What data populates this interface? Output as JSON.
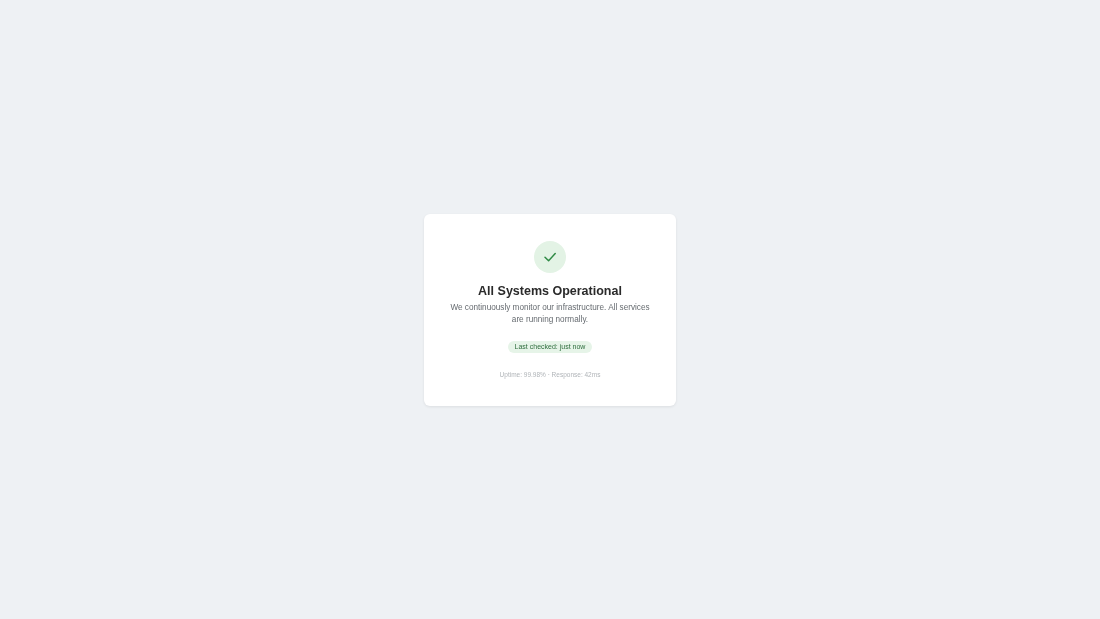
{
  "status_card": {
    "title": "All Systems Operational",
    "description": "We continuously monitor our infrastructure. All services are running normally.",
    "badge": "Last checked: just now",
    "footer": "Uptime: 99.98% · Response: 42ms"
  }
}
